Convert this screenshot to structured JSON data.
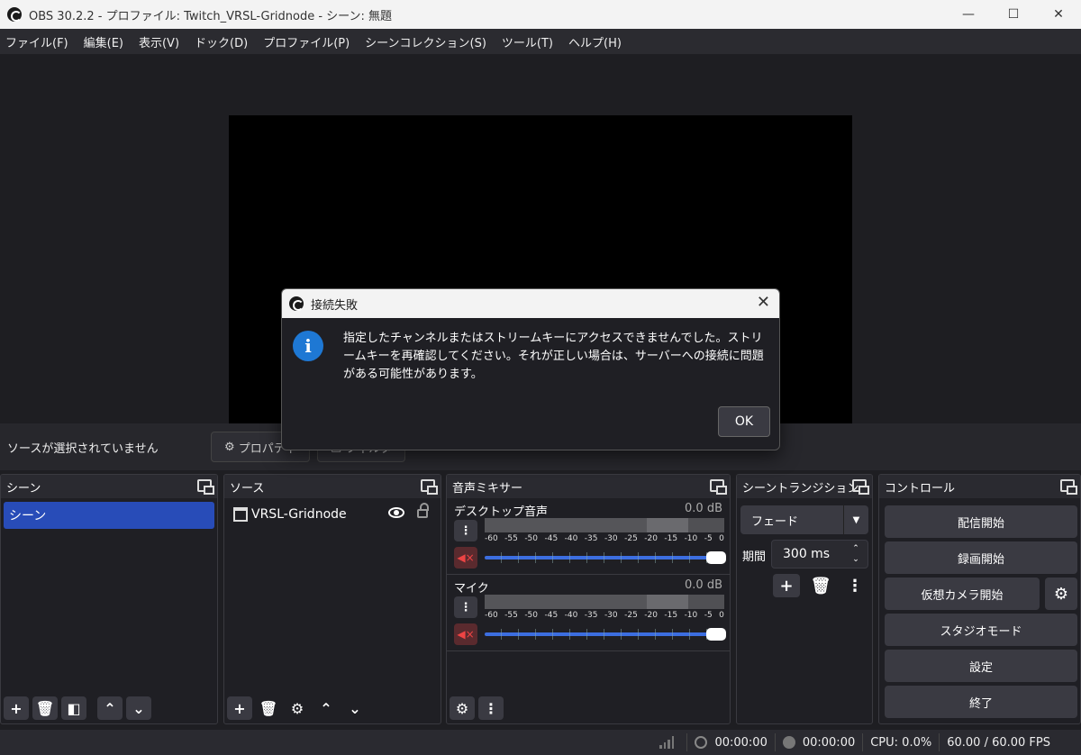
{
  "window": {
    "title": "OBS 30.2.2 - プロファイル: Twitch_VRSL-Gridnode - シーン: 無題"
  },
  "menu": [
    "ファイル(F)",
    "編集(E)",
    "表示(V)",
    "ドック(D)",
    "プロファイル(P)",
    "シーンコレクション(S)",
    "ツール(T)",
    "ヘルプ(H)"
  ],
  "source_toolbar": {
    "no_selection": "ソースが選択されていません",
    "properties": "プロパティ",
    "filters": "フィルタ"
  },
  "scenes": {
    "title": "シーン",
    "items": [
      "シーン"
    ]
  },
  "sources": {
    "title": "ソース",
    "items": [
      "VRSL-Gridnode"
    ]
  },
  "mixer": {
    "title": "音声ミキサー",
    "scale": [
      "-60",
      "-55",
      "-50",
      "-45",
      "-40",
      "-35",
      "-30",
      "-25",
      "-20",
      "-15",
      "-10",
      "-5",
      "0"
    ],
    "channels": [
      {
        "name": "デスクトップ音声",
        "db": "0.0 dB"
      },
      {
        "name": "マイク",
        "db": "0.0 dB"
      }
    ]
  },
  "transitions": {
    "title": "シーントランジション",
    "selected": "フェード",
    "duration_label": "期間",
    "duration": "300 ms"
  },
  "controls": {
    "title": "コントロール",
    "start_streaming": "配信開始",
    "start_recording": "録画開始",
    "start_virtual_camera": "仮想カメラ開始",
    "studio_mode": "スタジオモード",
    "settings": "設定",
    "exit": "終了"
  },
  "status": {
    "stream_time": "00:00:00",
    "record_time": "00:00:00",
    "cpu": "CPU: 0.0%",
    "fps": "60.00 / 60.00 FPS"
  },
  "dialog": {
    "title": "接続失敗",
    "message": "指定したチャンネルまたはストリームキーにアクセスできませんでした。ストリームキーを再確認してください。それが正しい場合は、サーバーへの接続に問題がある可能性があります。",
    "ok": "OK"
  },
  "icons": {
    "add": "+",
    "more": "⋮",
    "close": "✕"
  }
}
